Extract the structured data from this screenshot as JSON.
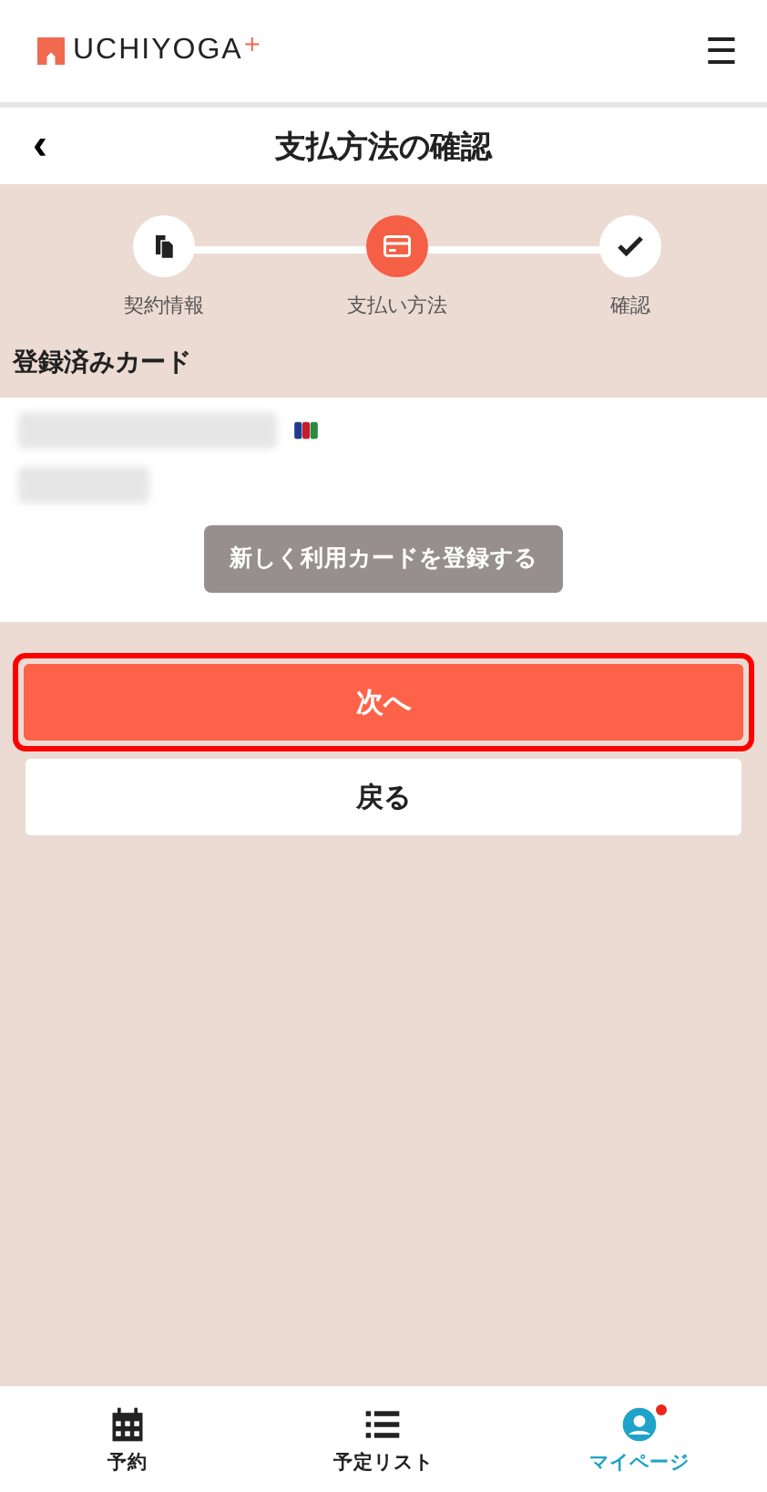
{
  "header": {
    "logo": "UCHIYOGA",
    "logo_mark": "+",
    "menu": "☰"
  },
  "title_bar": {
    "back": "‹",
    "title": "支払方法の確認"
  },
  "steps": [
    {
      "label": "契約情報",
      "kind": "documents",
      "selected": false
    },
    {
      "label": "支払い方法",
      "kind": "card",
      "selected": true
    },
    {
      "label": "確認",
      "kind": "check",
      "selected": false
    }
  ],
  "section_title": "登録済みカード",
  "register_button": "新しく利用カードを登録する",
  "next_button": {
    "label": "次へ",
    "highlighted": true
  },
  "back_button": "戻る",
  "bottom_nav": [
    {
      "label": "予約",
      "kind": "calendar",
      "selected": false,
      "badge": false
    },
    {
      "label": "予定リスト",
      "kind": "list",
      "selected": false,
      "badge": false
    },
    {
      "label": "マイページ",
      "kind": "person",
      "selected": true,
      "badge": true
    }
  ]
}
